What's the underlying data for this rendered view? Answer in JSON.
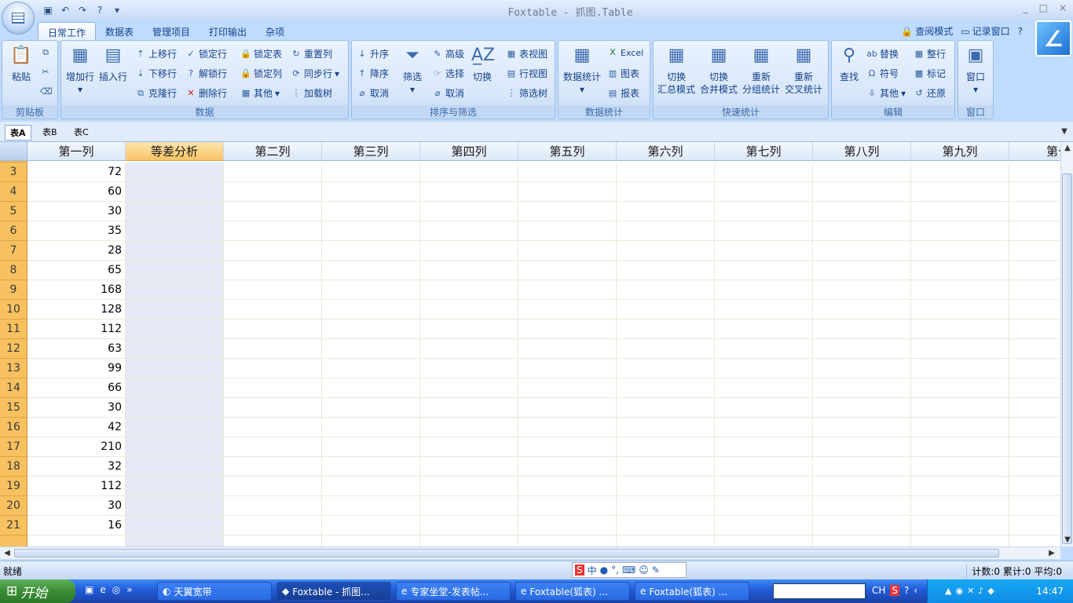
{
  "window": {
    "title": "Foxtable - 抓图.Table",
    "min": "_",
    "max": "□",
    "close": "×"
  },
  "ribbon_tabs": [
    "日常工作",
    "数据表",
    "管理项目",
    "打印输出",
    "杂项"
  ],
  "top_right": {
    "view_mode": "查阅模式",
    "record_window": "记录窗口",
    "help": "?"
  },
  "groups": {
    "clipboard": {
      "label": "剪贴板",
      "paste": "粘贴"
    },
    "data": {
      "label": "数据",
      "add_row": "增加行",
      "insert_row": "插入行",
      "move_up": "上移行",
      "move_down": "下移行",
      "clone_row": "克隆行",
      "lock_row": "锁定行",
      "unlock_row": "解锁行",
      "delete_row": "删除行",
      "lock_table": "锁定表",
      "lock_col": "锁定列",
      "other": "其他",
      "reset_col": "重置列",
      "sync_row": "同步行",
      "load_tree": "加载树"
    },
    "sort": {
      "label": "排序与筛选",
      "asc": "升序",
      "desc": "降序",
      "cancel": "取消",
      "filter": "筛选",
      "advanced": "高级",
      "select": "选择",
      "cancel2": "取消",
      "toggle": "切换",
      "table_view": "表视图",
      "row_view": "行视图",
      "filter_tree": "筛选树"
    },
    "stats": {
      "label": "数据统计",
      "data_stats": "数据统计",
      "excel": "Excel",
      "chart": "图表",
      "report": "报表"
    },
    "quick": {
      "label": "快速统计",
      "b1_l1": "切换",
      "b1_l2": "汇总模式",
      "b2_l1": "切换",
      "b2_l2": "合并模式",
      "b3_l1": "重新",
      "b3_l2": "分组统计",
      "b4_l1": "重新",
      "b4_l2": "交叉统计"
    },
    "edit": {
      "label": "编辑",
      "find": "查找",
      "replace": "替换",
      "symbol": "符号",
      "other": "其他",
      "whole_row": "整行",
      "mark": "标记",
      "restore": "还原"
    },
    "window": {
      "label": "窗口",
      "window": "窗口"
    }
  },
  "sheet_tabs": [
    "表A",
    "表B",
    "表C"
  ],
  "columns": [
    "第一列",
    "等差分析",
    "第二列",
    "第三列",
    "第四列",
    "第五列",
    "第六列",
    "第七列",
    "第八列",
    "第九列",
    "第十"
  ],
  "rows": [
    {
      "n": "3",
      "v": "72"
    },
    {
      "n": "4",
      "v": "60"
    },
    {
      "n": "5",
      "v": "30"
    },
    {
      "n": "6",
      "v": "35"
    },
    {
      "n": "7",
      "v": "28"
    },
    {
      "n": "8",
      "v": "65"
    },
    {
      "n": "9",
      "v": "168"
    },
    {
      "n": "10",
      "v": "128"
    },
    {
      "n": "11",
      "v": "112"
    },
    {
      "n": "12",
      "v": "63"
    },
    {
      "n": "13",
      "v": "99"
    },
    {
      "n": "14",
      "v": "66"
    },
    {
      "n": "15",
      "v": "30"
    },
    {
      "n": "16",
      "v": "42"
    },
    {
      "n": "17",
      "v": "210"
    },
    {
      "n": "18",
      "v": "32"
    },
    {
      "n": "19",
      "v": "112"
    },
    {
      "n": "20",
      "v": "30"
    },
    {
      "n": "21",
      "v": "16"
    }
  ],
  "status": {
    "left": "就绪",
    "right": "计数:0 累计:0 平均:0"
  },
  "taskbar": {
    "start": "开始",
    "items": [
      "天翼宽带",
      "Foxtable - 抓图...",
      "专家坐堂-发表帖...",
      "Foxtable(狐表) ...",
      "Foxtable(狐表) ..."
    ],
    "lang": "CH",
    "time": "14:47"
  }
}
